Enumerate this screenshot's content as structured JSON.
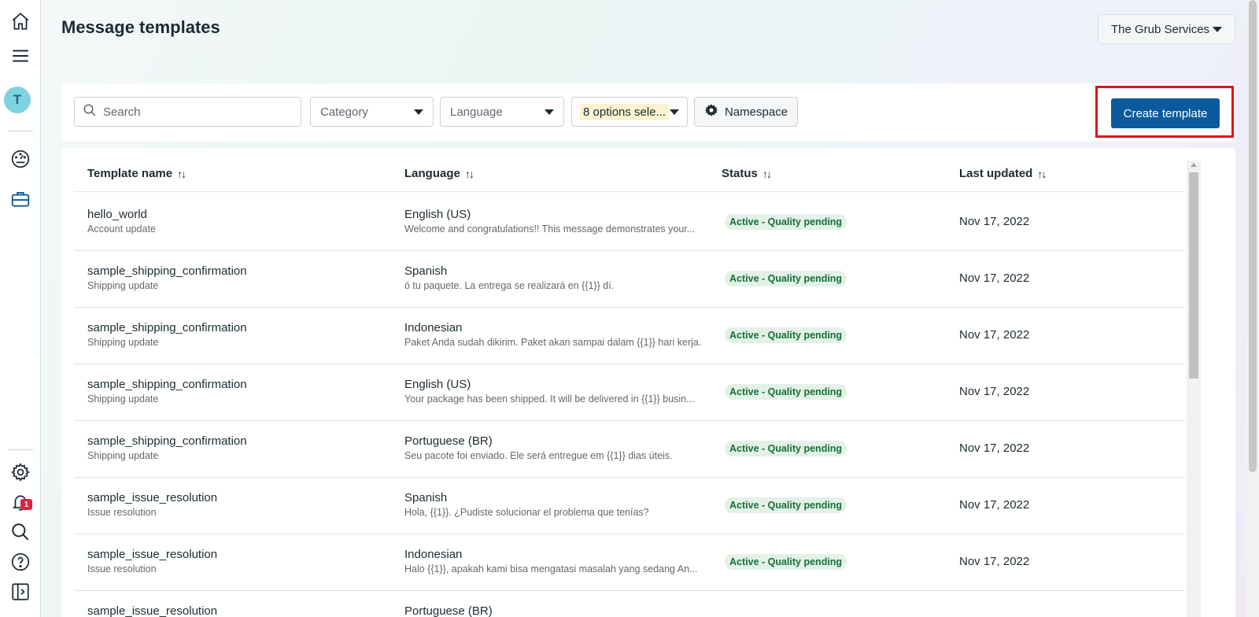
{
  "page": {
    "title": "Message templates"
  },
  "account": {
    "name": "The Grub Services"
  },
  "rail": {
    "avatar_letter": "T",
    "notification_count": "1",
    "icons": [
      "home-icon",
      "menu-icon",
      "dashboard-icon",
      "briefcase-icon",
      "gear-icon",
      "bell-icon",
      "search-icon",
      "help-icon",
      "panel-toggle-icon"
    ]
  },
  "toolbar": {
    "search_placeholder": "Search",
    "category_label": "Category",
    "language_label": "Language",
    "status_filter_label": "8 options sele...",
    "namespace_label": "Namespace",
    "create_label": "Create template"
  },
  "table": {
    "columns": [
      "Template name",
      "Language",
      "Status",
      "Last updated"
    ],
    "sort_glyph": "↑↓",
    "rows": [
      {
        "name": "hello_world",
        "category": "Account update",
        "language": "English (US)",
        "preview": "Welcome and congratulations!! This message demonstrates your...",
        "status": "Active - Quality pending",
        "updated": "Nov 17, 2022"
      },
      {
        "name": "sample_shipping_confirmation",
        "category": "Shipping update",
        "language": "Spanish",
        "preview": "ó tu paquete. La entrega se realizará en {{1}} dí.",
        "status": "Active - Quality pending",
        "updated": "Nov 17, 2022"
      },
      {
        "name": "sample_shipping_confirmation",
        "category": "Shipping update",
        "language": "Indonesian",
        "preview": "Paket Anda sudah dikirim. Paket akan sampai dalam {{1}} hari kerja.",
        "status": "Active - Quality pending",
        "updated": "Nov 17, 2022"
      },
      {
        "name": "sample_shipping_confirmation",
        "category": "Shipping update",
        "language": "English (US)",
        "preview": "Your package has been shipped. It will be delivered in {{1}} busin...",
        "status": "Active - Quality pending",
        "updated": "Nov 17, 2022"
      },
      {
        "name": "sample_shipping_confirmation",
        "category": "Shipping update",
        "language": "Portuguese (BR)",
        "preview": "Seu pacote foi enviado. Ele será entregue em {{1}} dias úteis.",
        "status": "Active - Quality pending",
        "updated": "Nov 17, 2022"
      },
      {
        "name": "sample_issue_resolution",
        "category": "Issue resolution",
        "language": "Spanish",
        "preview": "Hola, {{1}}. ¿Pudiste solucionar el problema que tenías?",
        "status": "Active - Quality pending",
        "updated": "Nov 17, 2022"
      },
      {
        "name": "sample_issue_resolution",
        "category": "Issue resolution",
        "language": "Indonesian",
        "preview": "Halo {{1}}, apakah kami bisa mengatasi masalah yang sedang An...",
        "status": "Active - Quality pending",
        "updated": "Nov 17, 2022"
      },
      {
        "name": "sample_issue_resolution",
        "category": "",
        "language": "Portuguese (BR)",
        "preview": "",
        "status": "",
        "updated": ""
      }
    ]
  },
  "colors": {
    "primary_button": "#0a5a9c",
    "highlight_box": "#e4111b",
    "status_bg": "#e3f1e6",
    "status_text": "#16703a",
    "filter_chip": "#fdf3d0"
  }
}
